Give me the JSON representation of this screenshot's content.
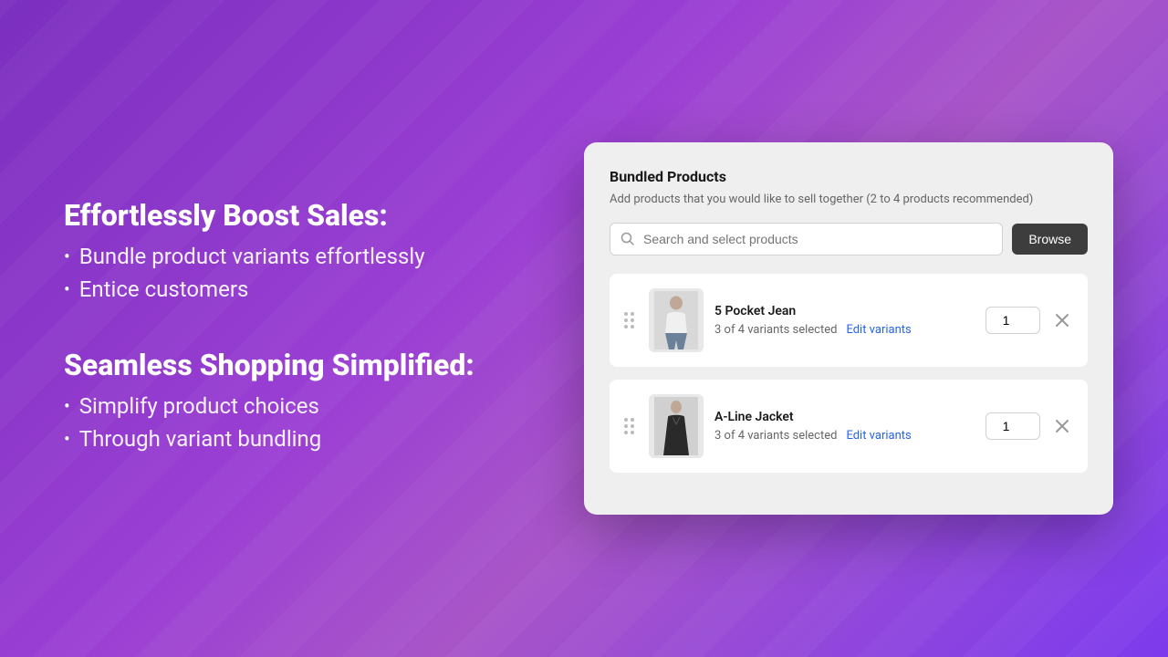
{
  "left": {
    "section1": {
      "heading": "Effortlessly Boost Sales:",
      "bullets": [
        "Bundle product variants effortlessly",
        "Entice customers"
      ]
    },
    "section2": {
      "heading": "Seamless Shopping Simplified:",
      "bullets": [
        "Simplify product choices",
        "Through variant bundling"
      ]
    }
  },
  "card": {
    "title": "Bundled Products",
    "subtitle": "Add products that you would like to sell together (2 to 4 products recommended)",
    "search": {
      "placeholder": "Search and select products"
    },
    "browse_label": "Browse",
    "products": [
      {
        "name": "5 Pocket Jean",
        "variants_text": "3 of 4 variants selected",
        "edit_label": "Edit variants",
        "quantity": "1",
        "thumb_color": "#d6d6d6",
        "silhouette": "light"
      },
      {
        "name": "A-Line Jacket",
        "variants_text": "3 of 4 variants selected",
        "edit_label": "Edit variants",
        "quantity": "1",
        "thumb_color": "#c8c8c8",
        "silhouette": "dark"
      }
    ]
  }
}
